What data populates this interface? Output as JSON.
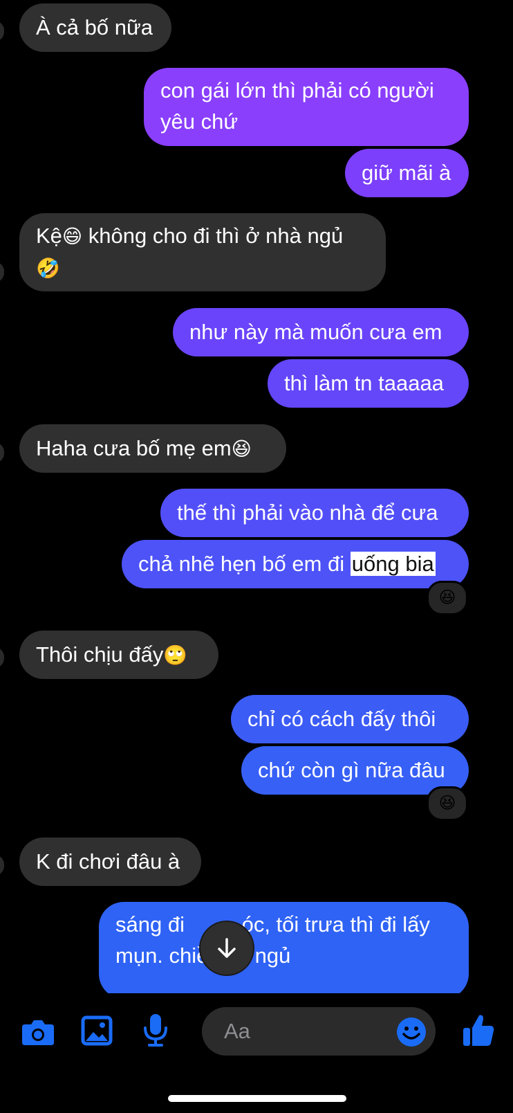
{
  "colors": {
    "background": "#000000",
    "incoming_bubble": "#303030",
    "outgoing_top": "#8a3ffc",
    "outgoing_mid": "#5b4bf7",
    "outgoing_bottom": "#2f63f5",
    "accent_icon": "#1a6cf7"
  },
  "messages": [
    {
      "dir": "in",
      "text": "À cả bố nữa"
    },
    {
      "dir": "out",
      "text": "con gái lớn thì phải có người yêu chứ"
    },
    {
      "dir": "out",
      "text": "giữ mãi à"
    },
    {
      "dir": "in",
      "text_a": "Kệ",
      "emoji_a": "😄",
      "text_b": " không cho đi thì ở nhà ngủ",
      "emoji_b": "🤣"
    },
    {
      "dir": "out",
      "text": "như này mà muốn cưa em"
    },
    {
      "dir": "out",
      "text": "thì làm tn taaaaa"
    },
    {
      "dir": "in",
      "text": "Haha cưa bố mẹ em",
      "emoji": "😆"
    },
    {
      "dir": "out",
      "text": "thế thì phải vào nhà để cưa"
    },
    {
      "dir": "out",
      "text": "chả nhẽ hẹn bố em đi ",
      "highlight": "uống bia",
      "reaction": "😆"
    },
    {
      "dir": "in",
      "text": "Thôi chịu đấy",
      "emoji": "🙄"
    },
    {
      "dir": "out",
      "text": "chỉ có cách đấy thôi"
    },
    {
      "dir": "out",
      "text": "chứ còn gì nữa đâu",
      "reaction": "😆"
    },
    {
      "dir": "in",
      "text": "K đi chơi đâu à"
    },
    {
      "dir": "out",
      "text_line1_a": "sáng đi ",
      "text_line1_b": "óc, tối trưa thì đi lấy",
      "text_line2": "mụn. chiều về ngủ"
    }
  ],
  "composer": {
    "placeholder": "Aa",
    "icons": [
      "camera-icon",
      "photo-icon",
      "microphone-icon",
      "emoji-icon",
      "thumbs-up-icon"
    ]
  },
  "scroll_button_icon": "arrow-down-icon"
}
